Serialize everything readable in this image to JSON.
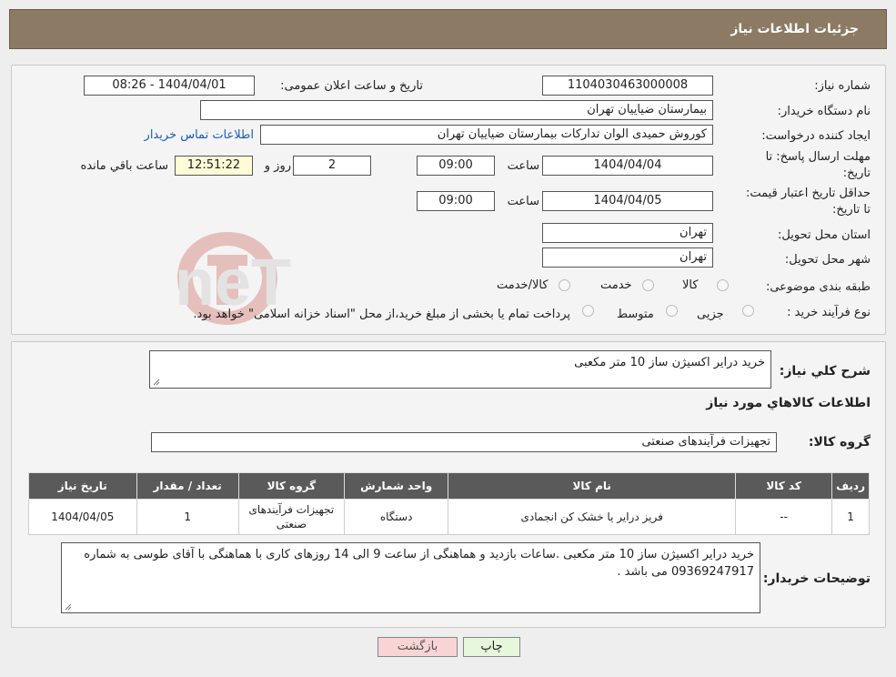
{
  "header": {
    "title": "جزئیات اطلاعات نیاز"
  },
  "form": {
    "need_number_label": "شماره نیاز:",
    "need_number": "1104030463000008",
    "announce_label": "تاریخ و ساعت اعلان عمومی:",
    "announce_value": "1404/04/01 - 08:26",
    "buyer_org_label": "نام دستگاه خریدار:",
    "buyer_org": "بیمارستان ضیاییان تهران",
    "requester_label": "ایجاد کننده درخواست:",
    "requester": "کوروش حمیدی الوان تداركات بيمارستان ضیاییان تهران",
    "contact_link": "اطلاعات تماس خریدار",
    "deadline_label": "مهلت ارسال پاسخ: تا تاریخ:",
    "deadline_date": "1404/04/04",
    "time_label": "ساعت",
    "deadline_time": "09:00",
    "days_value": "2",
    "days_label": "روز و",
    "remaining_time": "12:51:22",
    "remaining_label": "ساعت باقي مانده",
    "price_validity_label": "حداقل تاریخ اعتبار قیمت: تا تاریخ:",
    "price_validity_date": "1404/04/05",
    "price_validity_time": "09:00",
    "province_label": "استان محل تحویل:",
    "province": "تهران",
    "city_label": "شهر محل تحویل:",
    "city": "تهران",
    "category_label": "طبقه بندی موضوعی:",
    "category_options": [
      "کالا",
      "خدمت",
      "کالا/خدمت"
    ],
    "purchase_type_label": "نوع فرآیند خرید :",
    "purchase_type_options": [
      "جزیی",
      "متوسط"
    ],
    "payment_note": "پرداخت تمام یا بخشی از مبلغ خرید،از محل \"اسناد خزانه اسلامی\" خواهد بود."
  },
  "details": {
    "summary_label": "شرح کلي نياز:",
    "summary": "خرید درایر اکسیژن ساز 10 متر مکعبی",
    "goods_info_title": "اطلاعات کالاهاي مورد نياز",
    "goods_group_label": "گروه کالا:",
    "goods_group": "تجهیزات فرآیندهای صنعتی",
    "table": {
      "headers": [
        "ردیف",
        "کد کالا",
        "نام کالا",
        "واحد شمارش",
        "گروه کالا",
        "تعداد / مقدار",
        "تاریخ نیاز"
      ],
      "rows": [
        [
          "1",
          "--",
          "فریز درایر یا خشک کن انجمادی",
          "دستگاه",
          "تجهیزات فرآیندهای صنعتی",
          "1",
          "1404/04/05"
        ]
      ]
    },
    "buyer_notes_label": "توضیحات خریدار:",
    "buyer_notes": "خرید درایر اکسیژن ساز 10 متر مکعبی .ساعات بازدید و هماهنگی از ساعت 9 الی 14 روزهای کاری با هماهنگی با آقای طوسی به شماره 09369247917 می باشد ."
  },
  "buttons": {
    "print": "چاپ",
    "back": "بازگشت"
  },
  "watermark": {
    "text": "AriaTender.neT",
    "color": "#c0392b"
  }
}
